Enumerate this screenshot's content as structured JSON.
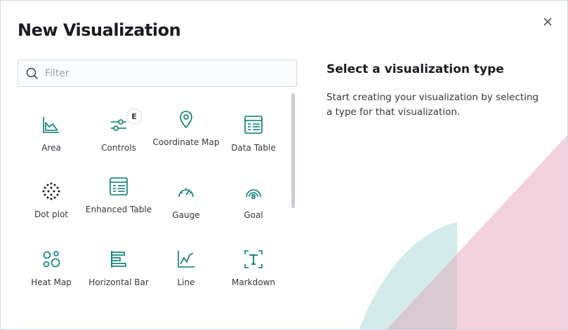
{
  "modal": {
    "title": "New Visualization",
    "close_icon": "close-icon"
  },
  "search": {
    "placeholder": "Filter",
    "value": "",
    "icon": "search-icon"
  },
  "types": [
    {
      "label": "Area",
      "icon": "area-chart-icon"
    },
    {
      "label": "Controls",
      "icon": "controls-icon",
      "badge": "E"
    },
    {
      "label": "Coordinate Map",
      "icon": "map-pin-icon"
    },
    {
      "label": "Data Table",
      "icon": "data-table-icon"
    },
    {
      "label": "Dot plot",
      "icon": "dot-plot-icon"
    },
    {
      "label": "Enhanced Table",
      "icon": "enhanced-table-icon"
    },
    {
      "label": "Gauge",
      "icon": "gauge-icon"
    },
    {
      "label": "Goal",
      "icon": "goal-icon"
    },
    {
      "label": "Heat Map",
      "icon": "heat-map-icon"
    },
    {
      "label": "Horizontal Bar",
      "icon": "horizontal-bar-icon"
    },
    {
      "label": "Line",
      "icon": "line-chart-icon"
    },
    {
      "label": "Markdown",
      "icon": "markdown-icon"
    }
  ],
  "info": {
    "title": "Select a visualization type",
    "description": "Start creating your visualization by selecting a type for that visualization."
  },
  "colors": {
    "accent": "#017d73",
    "text": "#343741",
    "border": "#d3dae6",
    "decor_pink": "#f0c6d4",
    "decor_teal": "#cce9e5"
  }
}
